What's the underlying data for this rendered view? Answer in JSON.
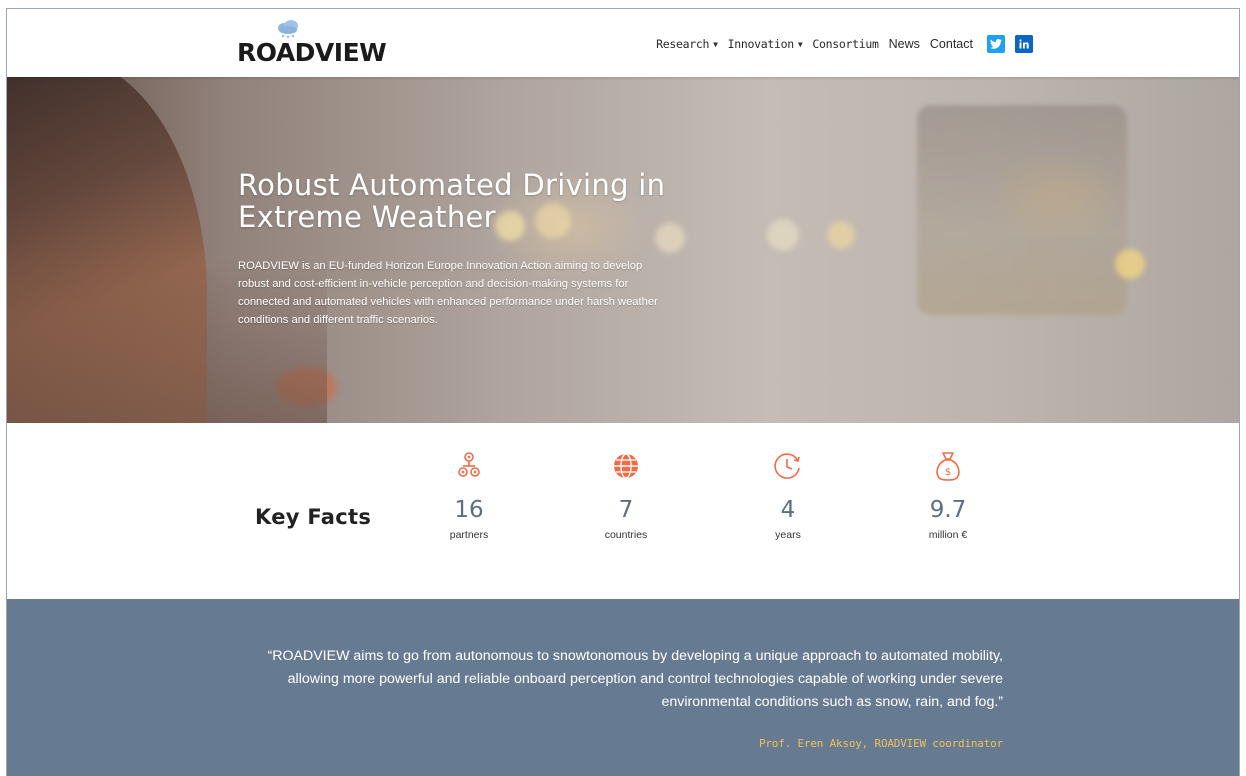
{
  "header": {
    "logo_text": "ROADVIEW",
    "nav": [
      {
        "label": "Research",
        "has_dropdown": true
      },
      {
        "label": "Innovation",
        "has_dropdown": true
      },
      {
        "label": "Consortium",
        "has_dropdown": false
      },
      {
        "label": "News",
        "has_dropdown": false
      },
      {
        "label": "Contact",
        "has_dropdown": false
      }
    ],
    "social": [
      {
        "icon": "twitter-icon",
        "color": "#1da1f2"
      },
      {
        "icon": "linkedin-icon",
        "color": "#0a66c2"
      }
    ]
  },
  "hero": {
    "title_line1": "Robust Automated Driving in",
    "title_line2": "Extreme Weather",
    "description": "ROADVIEW is an EU-funded Horizon Europe Innovation Action aiming to develop robust and cost-efficient in-vehicle perception and decision-making systems for connected and automated vehicles with enhanced performance under harsh weather conditions and different traffic scenarios."
  },
  "facts": {
    "title": "Key Facts",
    "accent_color": "#ef6c47",
    "items": [
      {
        "icon": "network-icon",
        "value": "16",
        "label": "partners"
      },
      {
        "icon": "globe-icon",
        "value": "7",
        "label": "countries"
      },
      {
        "icon": "clock-icon",
        "value": "4",
        "label": "years"
      },
      {
        "icon": "money-bag-icon",
        "value": "9.7",
        "label": "million €"
      }
    ]
  },
  "quote": {
    "text": "“ROADVIEW aims to go from autonomous to snowtonomous by developing a unique approach to automated mobility, allowing more powerful and reliable onboard perception and control technologies capable of working under severe environmental conditions such as snow, rain, and fog.”",
    "author": "Prof. Eren Aksoy, ROADVIEW coordinator",
    "background": "#667b92",
    "author_color": "#f0c05a"
  }
}
